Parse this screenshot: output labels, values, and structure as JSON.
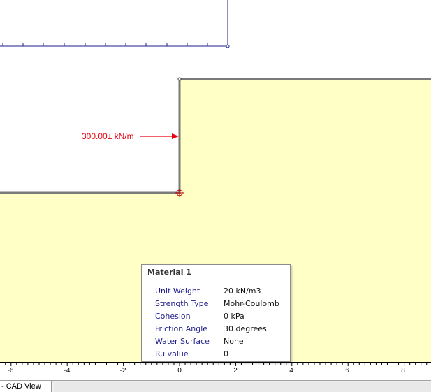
{
  "canvas": {
    "background": "#ffffff",
    "material_fill": "#ffffc6",
    "boundary_color": "#7a7a7a",
    "dimension_color": "#1f1f8f",
    "load_color": "#e8000b"
  },
  "distributed_load": {
    "label": "300.00± kN/m",
    "icon": "arrow-right-icon"
  },
  "ruler": {
    "ticks": [
      "-6",
      "-4",
      "-2",
      "0",
      "2",
      "4",
      "6",
      "8"
    ]
  },
  "tooltip": {
    "title": "Material 1",
    "properties": [
      {
        "key": "Unit Weight",
        "value": "20 kN/m3"
      },
      {
        "key": "Strength Type",
        "value": "Mohr-Coulomb"
      },
      {
        "key": "Cohesion",
        "value": "0 kPa"
      },
      {
        "key": "Friction Angle",
        "value": "30 degrees"
      },
      {
        "key": "Water Surface",
        "value": "None"
      },
      {
        "key": "Ru value",
        "value": "0"
      }
    ]
  },
  "tabs": [
    {
      "label": "- CAD View",
      "active": true
    }
  ]
}
